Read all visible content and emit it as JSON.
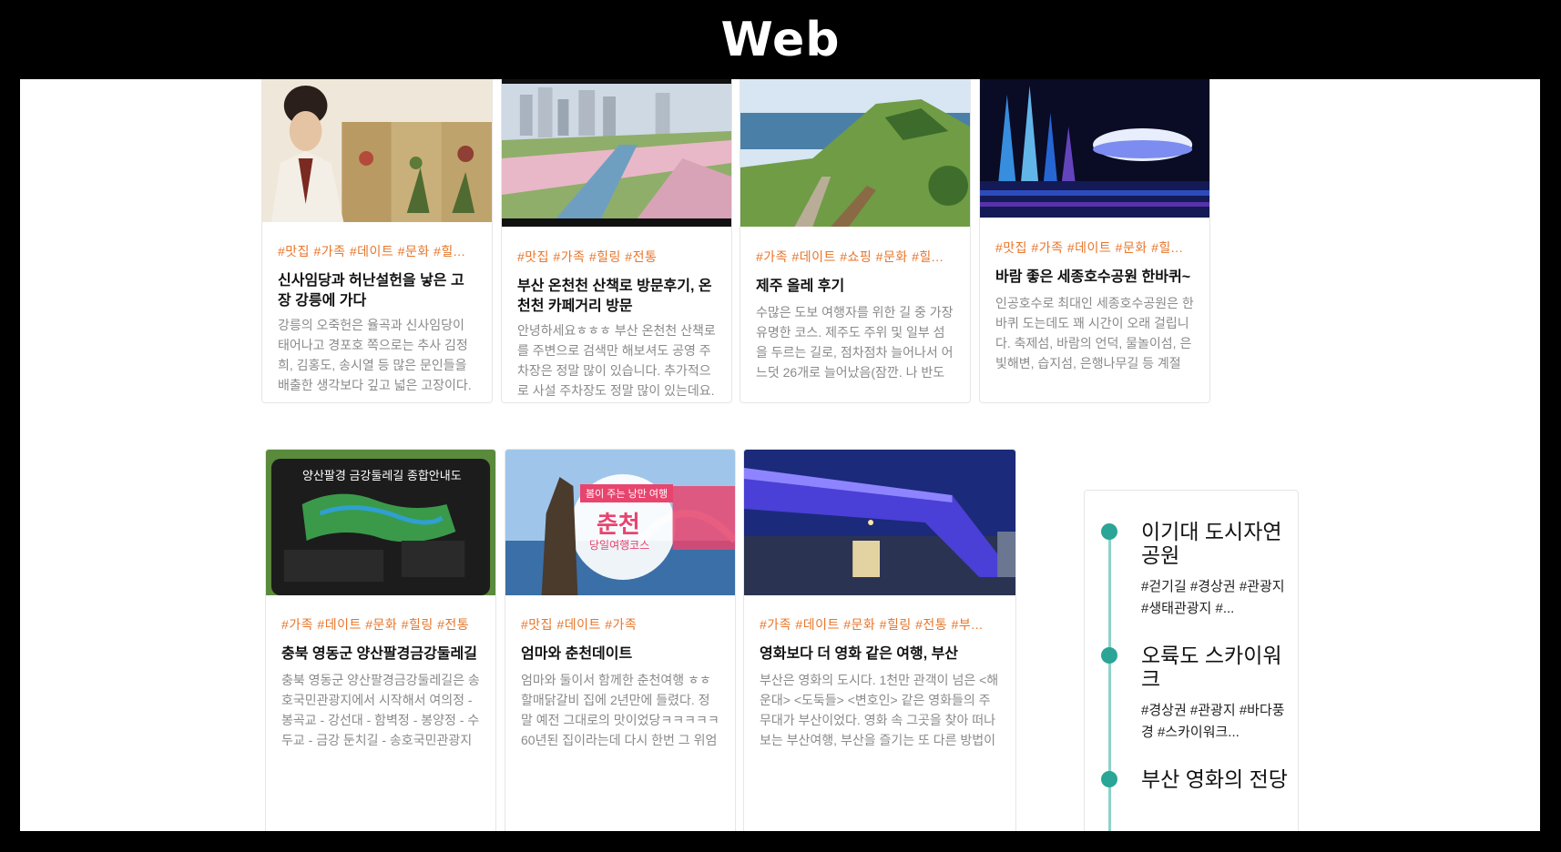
{
  "banner": {
    "title": "Web"
  },
  "colors": {
    "tag": "#e8752a",
    "timeline_dot": "#2aa596",
    "timeline_line": "#8fd3c7"
  },
  "cards_row1": [
    {
      "image": "portrait-with-flower-paintings",
      "tags": "#맛집 #가족 #데이트 #문화 #힐...",
      "title": "신사임당과 허난설헌을 낳은 고장 강릉에 가다",
      "desc": "강릉의 오죽헌은 율곡과 신사임당이 태어나고 경포호 쪽으로는 추사 김정희, 김홍도, 송시열 등 많은 문인들을 배출한 생각보다 깊고 넓은 고장이다. 특..."
    },
    {
      "image": "city-stream-with-cherry-blossoms",
      "tags": "#맛집 #가족 #힐링 #전통",
      "title": "부산 온천천 산책로 방문후기, 온천천 카페거리 방문",
      "desc": "안녕하세요ㅎㅎㅎ 부산 온천천 산책로를 주변으로 검색만 해보셔도 공영 주차장은 정말 많이 있습니다. 추가적으로 사설 주차장도 정말 많이 있는데요. ..."
    },
    {
      "image": "coastal-green-hill-trail",
      "tags": "#가족 #데이트 #쇼핑 #문화 #힐...",
      "title": "제주 올레 후기",
      "desc": "수많은 도보 여행자를 위한 길 중 가장 유명한 코스. 제주도 주위 및 일부 섬을 두르는 길로, 점차점차 늘어나서 어느덧 26개로 늘어났음(잠깐. 나 반도 못 ..."
    },
    {
      "image": "night-fountain-with-stadium",
      "tags": "#맛집 #가족 #데이트 #문화 #힐...",
      "title": "바람 좋은 세종호수공원 한바퀴~",
      "desc": "인공호수로 최대인 세종호수공원은 한바퀴 도는데도 꽤 시간이 오래 걸립니다. 축제섬, 바람의 언덕, 물놀이섬, 은빛해변, 습지섬, 은행나무길 등 계절마..."
    }
  ],
  "cards_row2": [
    {
      "image": "trail-map-signboard",
      "tags": "#가족 #데이트 #문화 #힐링 #전통",
      "title": "충북 영동군 양산팔경금강둘레길",
      "desc": "충북 영동군 양산팔경금강둘레길은 송호국민관광지에서 시작해서 여의정 - 봉곡교 - 강선대 - 함벽정 - 봉양정 - 수두교 - 금강 둔치길 - 송호국민관광지로 ...",
      "sign_title": "양산팔경 금강둘레길 종합안내도"
    },
    {
      "image": "statue-and-bridge-promo",
      "tags": "#맛집 #데이트 #가족",
      "title": "엄마와 춘천데이트",
      "desc": "엄마와 둘이서 함께한 춘천여행 ㅎㅎ 할매닭갈비 집에 2년만에 들렸다. 정말 예전 그대로의 맛이었당ㅋㅋㅋㅋㅋ 60년된 집이라는데 다시 한번 그 위엄을 ...",
      "promo_ribbon": "봄이 주는 낭만 여행",
      "promo_big": "춘천",
      "promo_sub": "당일여행코스"
    },
    {
      "image": "cinema-center-building",
      "tags": "#가족 #데이트 #문화 #힐링 #전통 #부...",
      "title": "영화보다 더 영화 같은 여행, 부산",
      "desc": "부산은 영화의 도시다. 1천만 관객이 넘은 <해운대> <도둑들> <변호인> 같은 영화들의 주 무대가 부산이었다. 영화 속 그곳을 찾아 떠나보는 부산여행, 부산을 즐기는 또 다른 방법이다. ..."
    }
  ],
  "timeline": [
    {
      "name": "이기대 도시자연공원",
      "tags": "#걷기길 #경상권 #관광지 #생태관광지 #..."
    },
    {
      "name": "오륙도 스카이워크",
      "tags": "#경상권 #관광지 #바다풍경 #스카이워크..."
    },
    {
      "name": "부산 영화의 전당",
      "tags": ""
    }
  ]
}
